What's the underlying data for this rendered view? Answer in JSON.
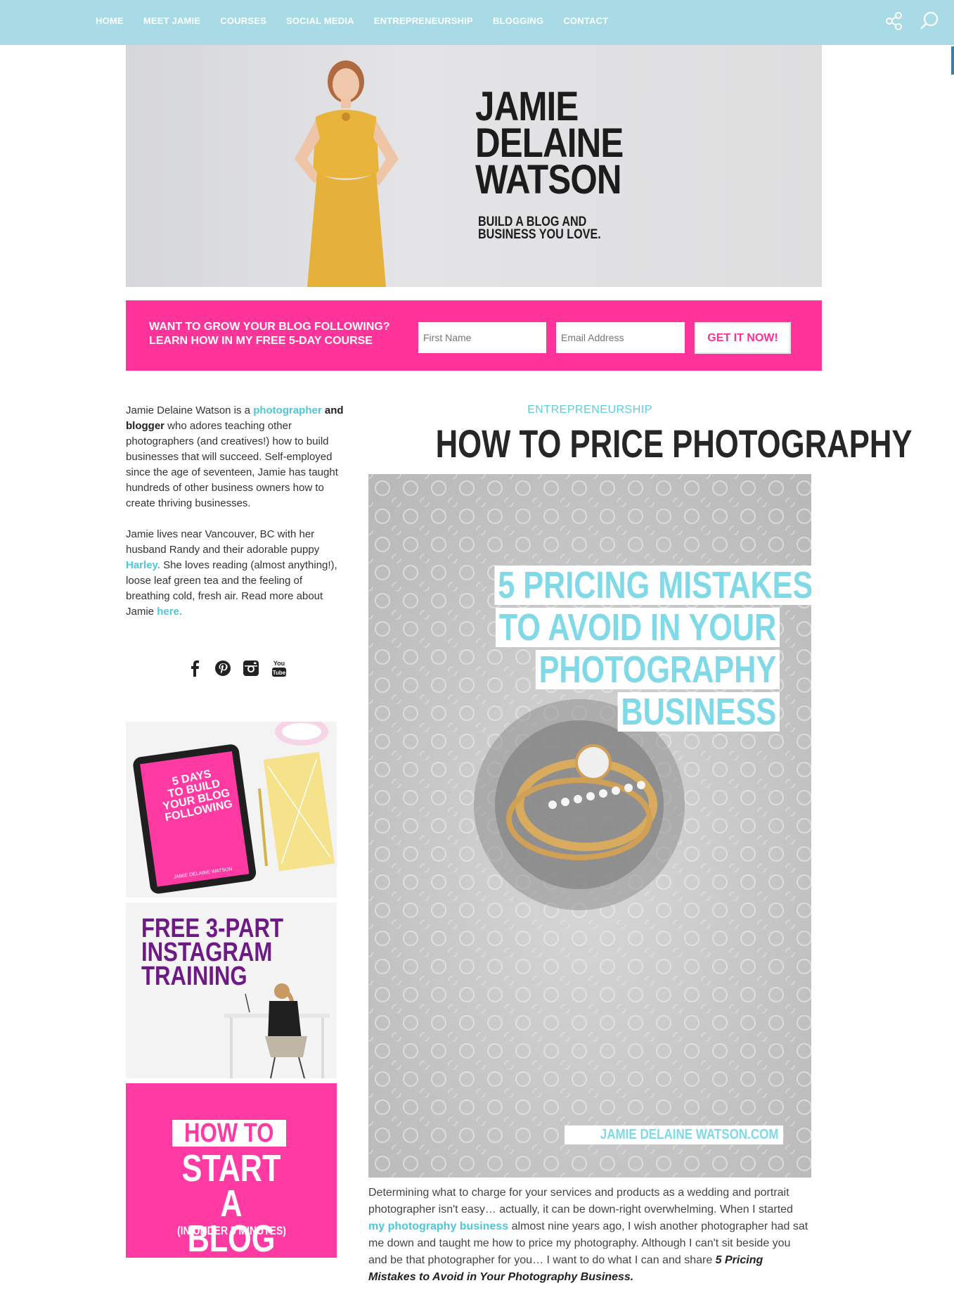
{
  "nav": {
    "items": [
      {
        "label": "HOME"
      },
      {
        "label": "MEET JAMIE"
      },
      {
        "label": "COURSES"
      },
      {
        "label": "SOCIAL MEDIA"
      },
      {
        "label": "ENTREPRENEURSHIP"
      },
      {
        "label": "BLOGGING"
      },
      {
        "label": "CONTACT"
      }
    ],
    "icons": [
      "share-icon",
      "search-icon"
    ]
  },
  "banner": {
    "title_lines": [
      "JAMIE",
      "DELAINE",
      "WATSON"
    ],
    "tagline_lines": [
      "BUILD A BLOG AND",
      "BUSINESS YOU LOVE."
    ]
  },
  "optin": {
    "line1": "WANT TO GROW YOUR BLOG FOLLOWING?",
    "line2": "LEARN HOW IN MY FREE 5-DAY COURSE",
    "first_name_placeholder": "First Name",
    "email_placeholder": "Email Address",
    "button_label": "GET IT NOW!",
    "color": "#ff3399"
  },
  "sidebar": {
    "bio1": {
      "pre": "Jamie Delaine Watson is a ",
      "link": "photographer",
      "bold": "and blogger",
      "post": " who adores teaching other photographers (and creatives!) how to build businesses that will succeed. Self-employed since the age of seventeen, Jamie has taught hundreds of other business owners how to create thriving businesses."
    },
    "bio2": {
      "pre": "Jamie lives near Vancouver, BC with her husband Randy and their adorable puppy ",
      "link1": "Harley.",
      "mid": " She loves reading (almost anything!), loose leaf green tea and the feeling of breathing cold, fresh air. Read more about Jamie ",
      "link2": "here."
    },
    "social_icons": [
      "facebook-icon",
      "pinterest-icon",
      "instagram-icon",
      "youtube-icon"
    ],
    "promo1": {
      "lines": [
        "5 DAYS",
        "TO BUILD",
        "YOUR BLOG",
        "FOLLOWING"
      ],
      "footer": "JAMIE DELAINE WATSON"
    },
    "promo2": {
      "lines": [
        "FREE 3-PART",
        "INSTAGRAM",
        "TRAINING"
      ]
    },
    "promo3": {
      "top": "HOW TO",
      "big1": "START",
      "big2": "A BLOG",
      "small": "(IN UNDER 5 MINUTES)"
    }
  },
  "post": {
    "category": "ENTREPRENEURSHIP",
    "title": "HOW TO PRICE PHOTOGRAPHY",
    "image_lines": [
      "5 PRICING MISTAKES",
      "TO AVOID IN YOUR",
      "PHOTOGRAPHY",
      "BUSINESS"
    ],
    "watermark": "JAMIE DELAINE WATSON.COM",
    "intro": {
      "pre": "Determining what to charge for your services and products as a wedding and portrait photographer isn't easy… actually, it can be down-right overwhelming. When I started ",
      "link": "my photography business",
      "mid": " almost nine years ago, I wish another photographer had sat me down and taught me how to price my photography. Although I can't sit beside you and be that photographer for you… I want to do what I can and share ",
      "em": "5 Pricing Mistakes to Avoid in Your Photography Business."
    }
  },
  "colors": {
    "nav_bg": "#a8dbe6",
    "accent_blue": "#4cc7dd",
    "pink": "#ff3399",
    "purple": "#6e1a85"
  }
}
